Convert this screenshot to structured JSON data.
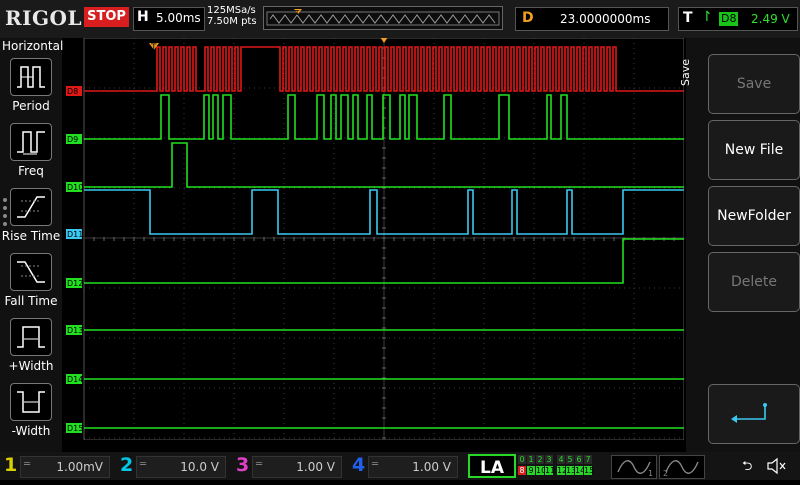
{
  "header": {
    "logo": "RIGOL",
    "run_state": "STOP",
    "horizontal": {
      "label": "H",
      "timebase": "5.00ms"
    },
    "sample_rate": "125MSa/s",
    "memory_points": "7.50M pts",
    "trigger_position_marker": "T",
    "delay": {
      "label": "D",
      "value": "23.0000000ms"
    },
    "trigger": {
      "label": "T",
      "source": "D8",
      "level": "2.49 V"
    }
  },
  "left_menu": {
    "title": "Horizontal",
    "items": [
      {
        "label": "Period",
        "icon": "period-measure-icon"
      },
      {
        "label": "Freq",
        "icon": "frequency-measure-icon"
      },
      {
        "label": "Rise Time",
        "icon": "rise-time-icon"
      },
      {
        "label": "Fall Time",
        "icon": "fall-time-icon"
      },
      {
        "label": "+Width",
        "icon": "positive-width-icon"
      },
      {
        "label": "-Width",
        "icon": "negative-width-icon"
      }
    ]
  },
  "right_menu": {
    "tab": "Save",
    "buttons": [
      {
        "label": "Save",
        "enabled": false
      },
      {
        "label": "New File",
        "enabled": true
      },
      {
        "label": "NewFolder",
        "enabled": true
      },
      {
        "label": "Delete",
        "enabled": false
      }
    ],
    "enter_icon": "enter-return-icon"
  },
  "trace_area": {
    "trigger_marker": "T",
    "colors": {
      "grid": "#3a3a3a",
      "trigger_trace": "#e01818",
      "digital": "#20e020",
      "selected": "#3ac8f0"
    },
    "channels": [
      {
        "label": "D8",
        "color": "#e01818",
        "edges": [
          157,
          160,
          163,
          166,
          169,
          172,
          175,
          178,
          181,
          184,
          187,
          190,
          193,
          196,
          205,
          208,
          211,
          214,
          217,
          220,
          223,
          226,
          229,
          232,
          235,
          238,
          241,
          280,
          283,
          286,
          289,
          292,
          295,
          298,
          301,
          304,
          307,
          310,
          313,
          316,
          319,
          322,
          325,
          328,
          331,
          334,
          337,
          340,
          343,
          346,
          349,
          352,
          355,
          358,
          361,
          364,
          367,
          370,
          373,
          376,
          379,
          382,
          385,
          388,
          391,
          394,
          397,
          400,
          403,
          406,
          409,
          412,
          415,
          418,
          421,
          424,
          427,
          430,
          433,
          436,
          439,
          442,
          445,
          448,
          451,
          454,
          457,
          460,
          463,
          466,
          469,
          472,
          475,
          478,
          481,
          484,
          487,
          490,
          493,
          496,
          499,
          502,
          505,
          508,
          511,
          514,
          517,
          520,
          523,
          526,
          529,
          532,
          535,
          538,
          541,
          544,
          547,
          550,
          553,
          556,
          559,
          562,
          565,
          568,
          571,
          574,
          577,
          580,
          583,
          586,
          589,
          592,
          595,
          598,
          601,
          604,
          607,
          610,
          613,
          616
        ]
      },
      {
        "label": "D9",
        "color": "#20e020",
        "edges": [
          161,
          169,
          204,
          209,
          213,
          218,
          223,
          231,
          288,
          295,
          317,
          324,
          331,
          336,
          341,
          348,
          353,
          358,
          367,
          372,
          383,
          390,
          400,
          405,
          409,
          417,
          444,
          451,
          499,
          509,
          547,
          551,
          561,
          567
        ]
      },
      {
        "label": "D10",
        "color": "#20e020",
        "edges": [
          172,
          187
        ]
      },
      {
        "label": "D11",
        "color": "#3ac8f0",
        "start_high": true,
        "edges": [
          150,
          252,
          278,
          370,
          377,
          468,
          473,
          512,
          517,
          567,
          572,
          623
        ]
      },
      {
        "label": "D12",
        "color": "#20e020",
        "edges": [
          623
        ]
      },
      {
        "label": "D13",
        "color": "#20e020",
        "edges": []
      },
      {
        "label": "D14",
        "color": "#20e020",
        "edges": []
      },
      {
        "label": "D15",
        "color": "#20e020",
        "edges": []
      }
    ]
  },
  "bottom_bar": {
    "channels": [
      {
        "num": "1",
        "color": "#d8d000",
        "scale": "1.00mV"
      },
      {
        "num": "2",
        "color": "#00c8e8",
        "scale": "10.0 V"
      },
      {
        "num": "3",
        "color": "#e040c8",
        "scale": "1.00 V"
      },
      {
        "num": "4",
        "color": "#2060f0",
        "scale": "1.00 V"
      }
    ],
    "la": {
      "label": "LA",
      "row1": [
        "0",
        "1",
        "2",
        "3",
        "4",
        "5",
        "6",
        "7"
      ],
      "row2": [
        "8",
        "9",
        "10",
        "11",
        "12",
        "13",
        "14",
        "15"
      ]
    },
    "generators": [
      {
        "num": "1",
        "icon": "sine-wave-icon"
      },
      {
        "num": "2",
        "icon": "sine-wave-icon"
      }
    ],
    "usb_icon": "usb-icon",
    "speaker_icon": "speaker-muted-icon"
  }
}
